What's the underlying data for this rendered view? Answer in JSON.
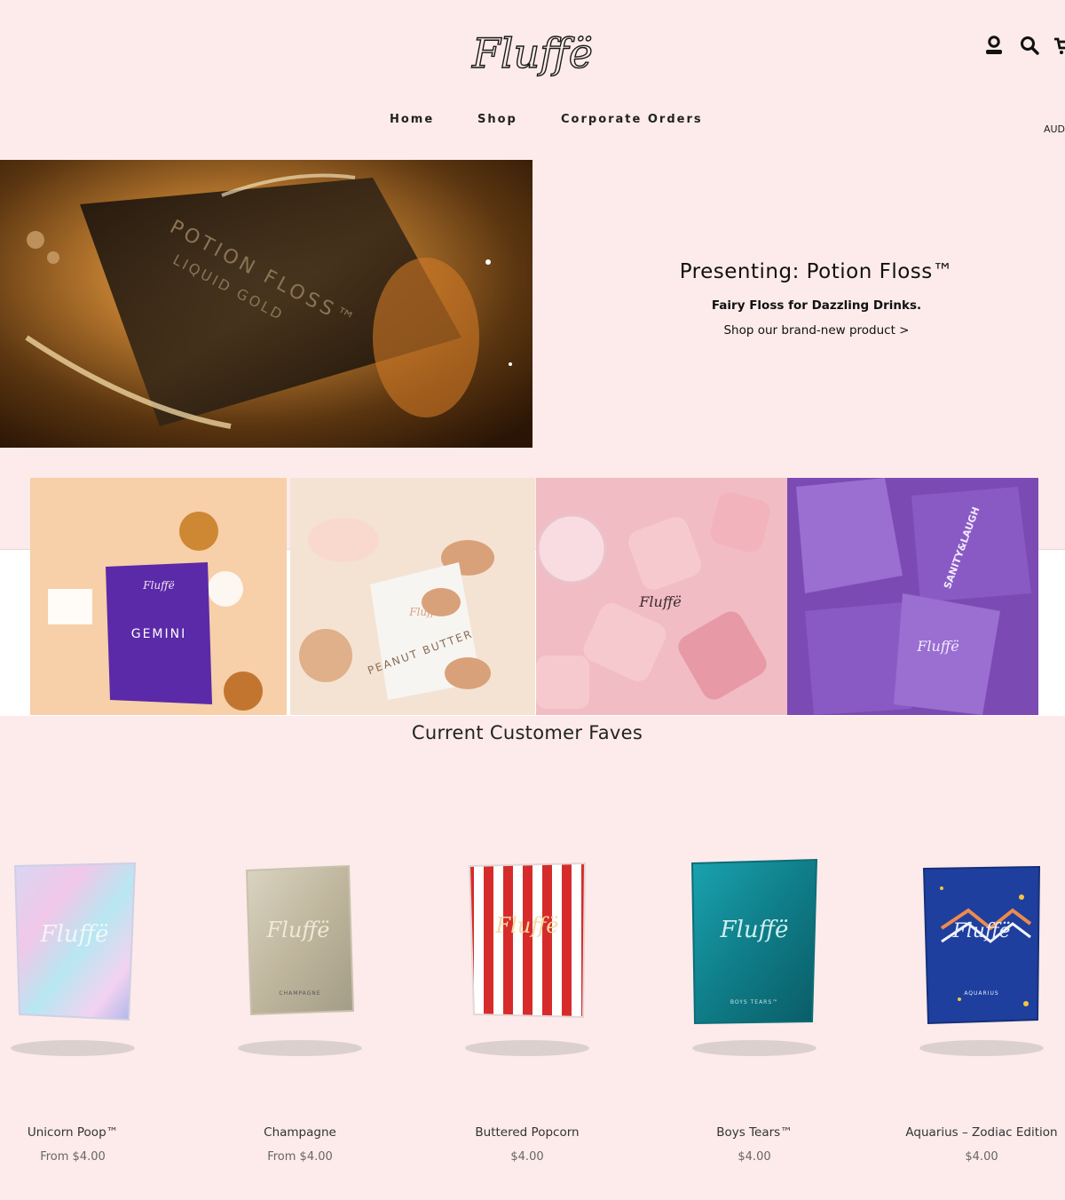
{
  "header": {
    "brand": "Fluffë",
    "icons": [
      "account-icon",
      "search-icon",
      "cart-icon"
    ],
    "nav": [
      "Home",
      "Shop",
      "Corporate Orders"
    ],
    "currency": "AUD"
  },
  "hero": {
    "title": "Presenting: Potion Floss™",
    "subtitle": "Fairy Floss for Dazzling Drinks.",
    "link": "Shop our brand-new product >",
    "image_text": [
      "POTION FLOSS™",
      "LIQUID GOLD"
    ]
  },
  "tiles": [
    {
      "label": "GEMINI",
      "brand": "Fluffë",
      "colors": [
        "#f7cfa8",
        "#5a2aa8"
      ]
    },
    {
      "label": "PEANUT BUTTER",
      "brand": "Fluffë",
      "colors": [
        "#f4e3d3",
        "#d9a17a"
      ]
    },
    {
      "label": "",
      "brand": "Fluffë",
      "colors": [
        "#f6c9cf",
        "#e79aa6"
      ]
    },
    {
      "label": "SANITY&LAUGH",
      "brand": "Fluffë",
      "colors": [
        "#7b4bb3",
        "#9b6ed1"
      ]
    }
  ],
  "faves": {
    "title": "Current Customer Faves",
    "products": [
      {
        "name": "Unicorn Poop™",
        "price": "From $4.00",
        "pack_text": ""
      },
      {
        "name": "Champagne",
        "price": "From $4.00",
        "pack_text": "CHAMPAGNE"
      },
      {
        "name": "Buttered Popcorn",
        "price": "$4.00",
        "pack_text": ""
      },
      {
        "name": "Boys Tears™",
        "price": "$4.00",
        "pack_text": "BOYS TEARS™"
      },
      {
        "name": "Aquarius – Zodiac Edition",
        "price": "$4.00",
        "pack_text": "AQUARIUS"
      }
    ]
  },
  "colors": {
    "background": "#fcebea",
    "text": "#1c1c1c"
  }
}
